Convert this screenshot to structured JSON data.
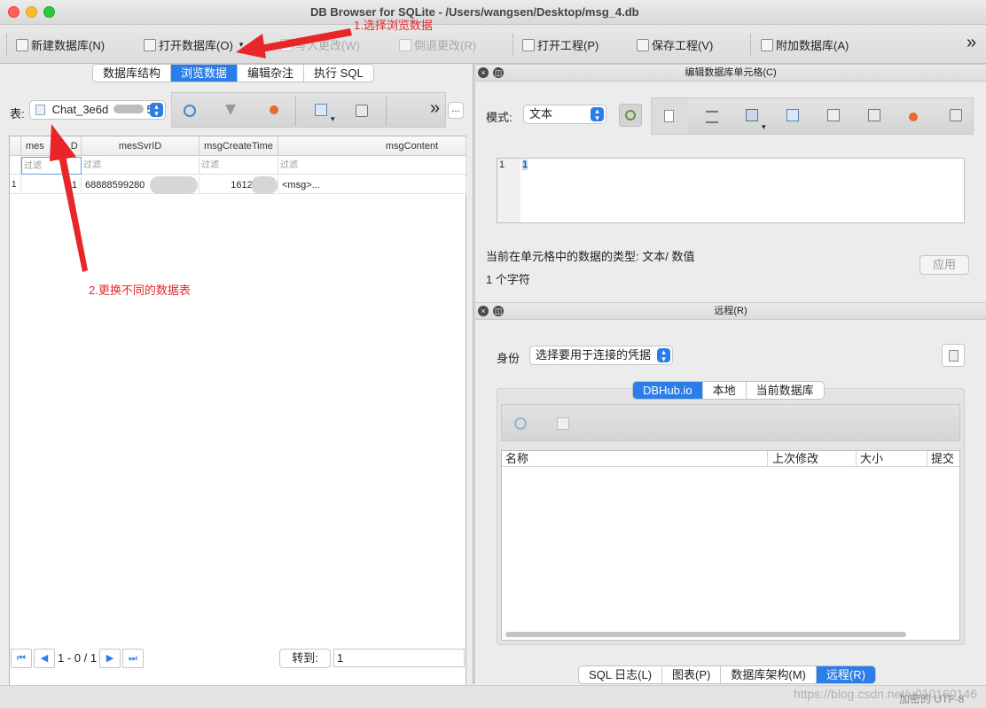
{
  "window": {
    "title": "DB Browser for SQLite - /Users/wangsen/Desktop/msg_4.db"
  },
  "toolbar": {
    "new_db": "新建数据库(N)",
    "open_db": "打开数据库(O)",
    "write_changes": "写入更改(W)",
    "revert_changes": "倒退更改(R)",
    "open_project": "打开工程(P)",
    "save_project": "保存工程(V)",
    "attach_db": "附加数据库(A)",
    "overflow": "»"
  },
  "left": {
    "tabs": [
      "数据库结构",
      "浏览数据",
      "编辑杂注",
      "执行 SQL"
    ],
    "active_tab": 1,
    "table_label": "表:",
    "table_select": "Chat_3e6d",
    "table_select_suffix": "5",
    "more_button": "...",
    "overflow": "»",
    "columns": [
      "mesLocalID",
      "mesSvrID",
      "msgCreateTime",
      "msgContent"
    ],
    "column_display": [
      "mes",
      "mesSvrID",
      "msgCreateTime",
      "msgContent"
    ],
    "column_id_partial": "D",
    "filter_placeholder": "过滤",
    "rows": [
      {
        "index": "1",
        "cells": [
          "1",
          "68888599280",
          "161201",
          "<msg>..."
        ]
      }
    ],
    "pager": {
      "text": "1 - 0 / 1",
      "goto_label": "转到:",
      "goto_value": "1"
    }
  },
  "editor": {
    "header": "编辑数据库单元格(C)",
    "mode_label": "模式:",
    "mode_value": "文本",
    "line_number": "1",
    "cell_text": "1",
    "type_info": "当前在单元格中的数据的类型: 文本/ 数值",
    "size_info": "1 个字符",
    "apply": "应用"
  },
  "remote": {
    "header": "远程(R)",
    "identity_label": "身份",
    "identity_value": "选择要用于连接的凭据",
    "tabs": [
      "DBHub.io",
      "本地",
      "当前数据库"
    ],
    "active_tab": 0,
    "columns": [
      "名称",
      "上次修改",
      "大小",
      "提交"
    ]
  },
  "bottom_tabs": [
    "SQL 日志(L)",
    "图表(P)",
    "数据库架构(M)",
    "远程(R)"
  ],
  "bottom_active": 3,
  "status": {
    "encoding": "加密的  UTF-8"
  },
  "annotations": {
    "step1": "1.选择浏览数据",
    "step2": "2.更换不同的数据表"
  },
  "watermark": "https://blog.csdn.net/u010160146",
  "colors": {
    "accent": "#2b7de9",
    "annotation": "#e8262a"
  }
}
